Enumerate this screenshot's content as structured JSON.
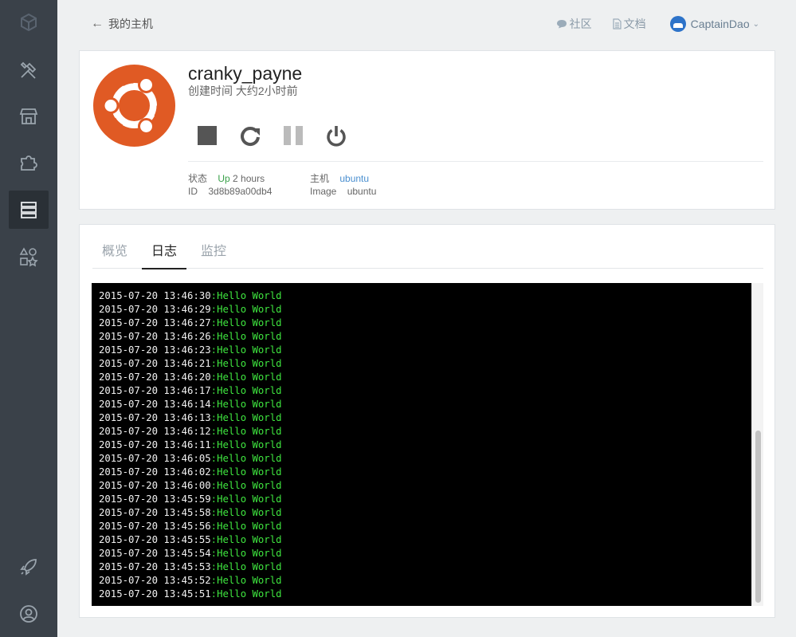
{
  "header": {
    "back_label": "我的主机",
    "community_label": "社区",
    "docs_label": "文档",
    "username": "CaptainDao"
  },
  "container": {
    "name": "cranky_payne",
    "created": "创建时间 大约2小时前",
    "status_label": "状态",
    "status_state": "Up",
    "status_duration": "2 hours",
    "id_label": "ID",
    "id_value": "3d8b89a00db4",
    "host_label": "主机",
    "host_value": "ubuntu",
    "image_label": "Image",
    "image_value": "ubuntu"
  },
  "tabs": [
    "概览",
    "日志",
    "监控"
  ],
  "active_tab": 1,
  "log_separator": ":",
  "logs": [
    {
      "ts": "2015-07-20 13:46:30",
      "msg": "Hello World"
    },
    {
      "ts": "2015-07-20 13:46:29",
      "msg": "Hello World"
    },
    {
      "ts": "2015-07-20 13:46:27",
      "msg": "Hello World"
    },
    {
      "ts": "2015-07-20 13:46:26",
      "msg": "Hello World"
    },
    {
      "ts": "2015-07-20 13:46:23",
      "msg": "Hello World"
    },
    {
      "ts": "2015-07-20 13:46:21",
      "msg": "Hello World"
    },
    {
      "ts": "2015-07-20 13:46:20",
      "msg": "Hello World"
    },
    {
      "ts": "2015-07-20 13:46:17",
      "msg": "Hello World"
    },
    {
      "ts": "2015-07-20 13:46:14",
      "msg": "Hello World"
    },
    {
      "ts": "2015-07-20 13:46:13",
      "msg": "Hello World"
    },
    {
      "ts": "2015-07-20 13:46:12",
      "msg": "Hello World"
    },
    {
      "ts": "2015-07-20 13:46:11",
      "msg": "Hello World"
    },
    {
      "ts": "2015-07-20 13:46:05",
      "msg": "Hello World"
    },
    {
      "ts": "2015-07-20 13:46:02",
      "msg": "Hello World"
    },
    {
      "ts": "2015-07-20 13:46:00",
      "msg": "Hello World"
    },
    {
      "ts": "2015-07-20 13:45:59",
      "msg": "Hello World"
    },
    {
      "ts": "2015-07-20 13:45:58",
      "msg": "Hello World"
    },
    {
      "ts": "2015-07-20 13:45:56",
      "msg": "Hello World"
    },
    {
      "ts": "2015-07-20 13:45:55",
      "msg": "Hello World"
    },
    {
      "ts": "2015-07-20 13:45:54",
      "msg": "Hello World"
    },
    {
      "ts": "2015-07-20 13:45:53",
      "msg": "Hello World"
    },
    {
      "ts": "2015-07-20 13:45:52",
      "msg": "Hello World"
    },
    {
      "ts": "2015-07-20 13:45:51",
      "msg": "Hello World"
    }
  ],
  "sidebar_icons": [
    "logo-cube-icon",
    "tools-icon",
    "store-icon",
    "puzzle-icon",
    "servers-icon",
    "shapes-icon",
    "rocket-icon",
    "user-icon"
  ],
  "colors": {
    "sidebar_bg": "#3a4149",
    "ubuntu_orange": "#e05a24",
    "status_up": "#3aa14a",
    "link_blue": "#4a8fd0",
    "log_message": "#3fe63f"
  }
}
